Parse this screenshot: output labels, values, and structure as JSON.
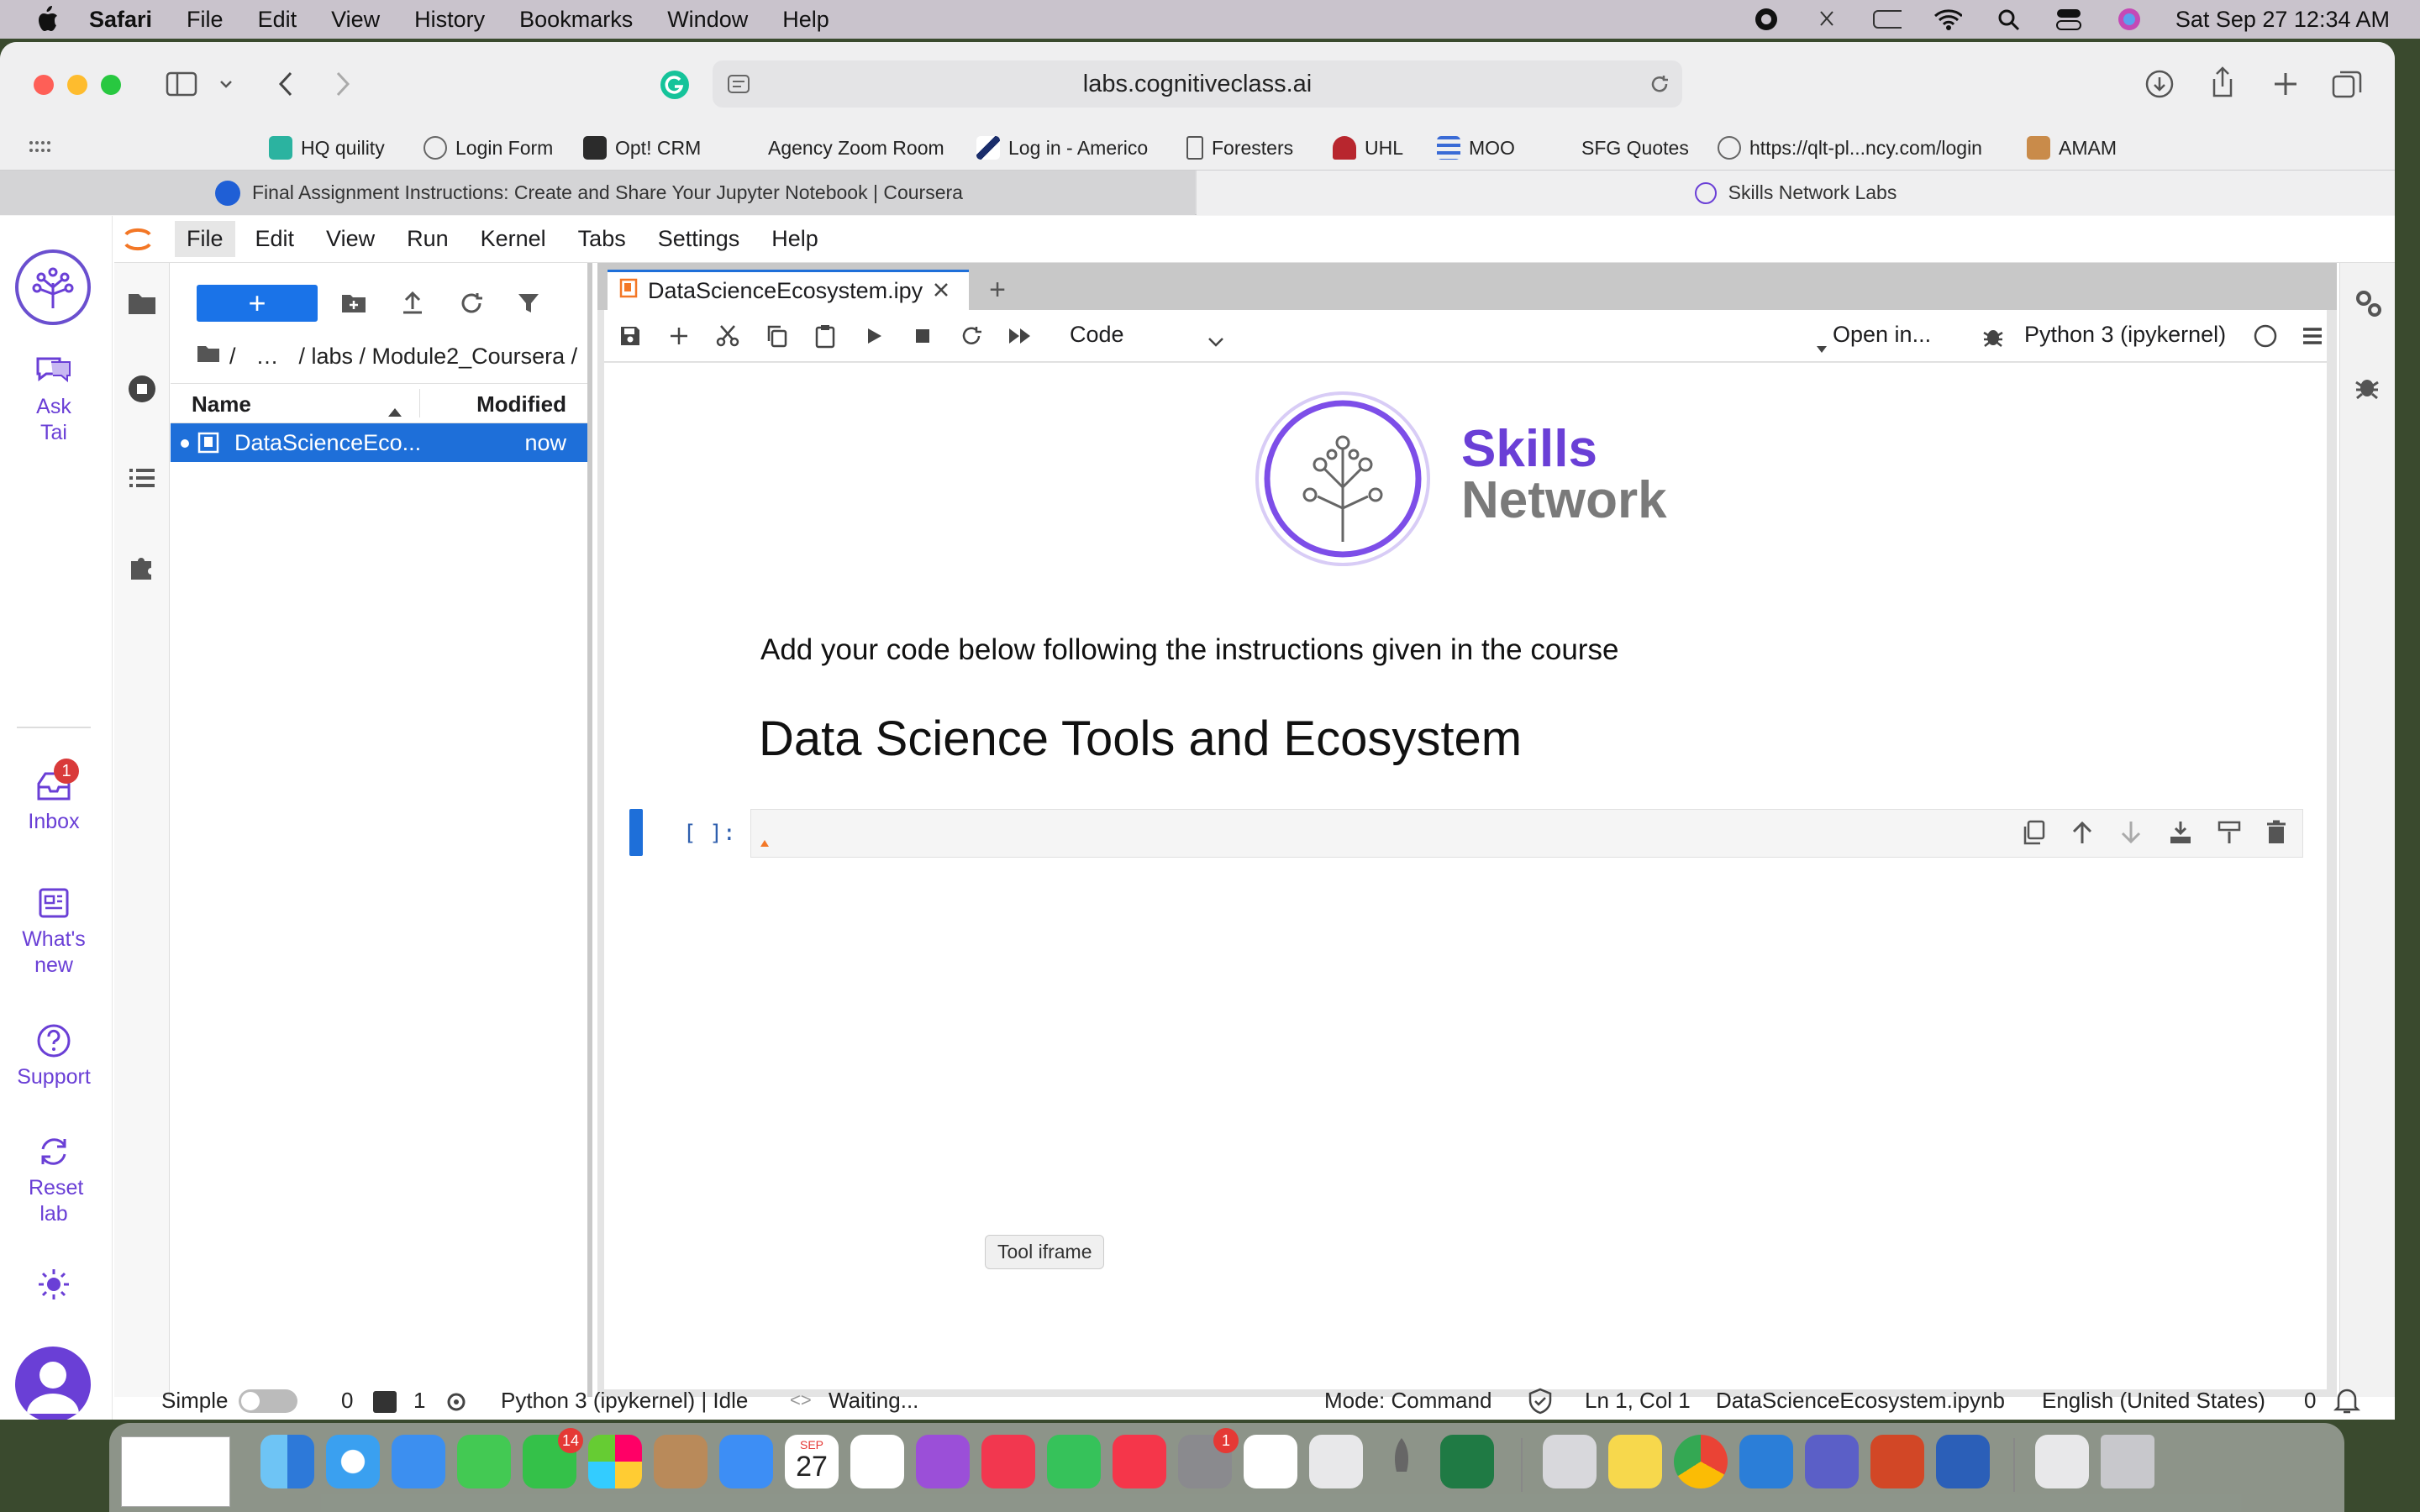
{
  "menubar": {
    "app": "Safari",
    "items": [
      "File",
      "Edit",
      "View",
      "History",
      "Bookmarks",
      "Window",
      "Help"
    ],
    "clock": "Sat Sep 27  12:34 AM"
  },
  "browser": {
    "url": "labs.cognitiveclass.ai",
    "bookmarks": [
      "HQ quility",
      "Login Form",
      "Opt! CRM",
      "Agency Zoom Room",
      "Log in - Americo",
      "Foresters",
      "UHL",
      "MOO",
      "SFG Quotes",
      "https://qlt-pl...ncy.com/login",
      "AMAM"
    ],
    "tabs": [
      "Final Assignment Instructions: Create and Share Your Jupyter Notebook | Coursera",
      "Skills Network Labs"
    ]
  },
  "skills_nav": {
    "ask": "Ask Tai",
    "inbox": "Inbox",
    "inbox_badge": "1",
    "whats_new": "What's new",
    "support": "Support",
    "reset": "Reset lab"
  },
  "jupyter": {
    "menu": [
      "File",
      "Edit",
      "View",
      "Run",
      "Kernel",
      "Tabs",
      "Settings",
      "Help"
    ],
    "breadcrumbs": [
      "/",
      "…",
      "/ labs / Module2_Coursera /"
    ],
    "columns": {
      "name": "Name",
      "modified": "Modified"
    },
    "file": {
      "name": "DataScienceEco...",
      "modified": "now"
    },
    "tab_title": "DataScienceEcosystem.ipy",
    "cell_type": "Code",
    "open_in": "Open in...",
    "kernel": "Python 3 (ipykernel)",
    "logo_line1": "Skills",
    "logo_line2": "Network",
    "instruction": "Add your code below following the instructions given in the course",
    "heading": "Data Science Tools and Ecosystem",
    "prompt": "[ ]:",
    "tooltip": "Tool iframe"
  },
  "status": {
    "simple": "Simple",
    "zero": "0",
    "one": "1",
    "kernel_state": "Python 3 (ipykernel) | Idle",
    "waiting": "Waiting...",
    "mode": "Mode: Command",
    "position": "Ln 1, Col 1",
    "filename": "DataScienceEcosystem.ipynb",
    "language": "English (United States)",
    "notifications": "0"
  },
  "dock": {
    "calendar_month": "SEP",
    "calendar_day": "27",
    "facetime_badge": "14",
    "settings_badge": "1"
  },
  "colors": {
    "accent": "#6a3fd6",
    "selection": "#1e6fd9"
  }
}
